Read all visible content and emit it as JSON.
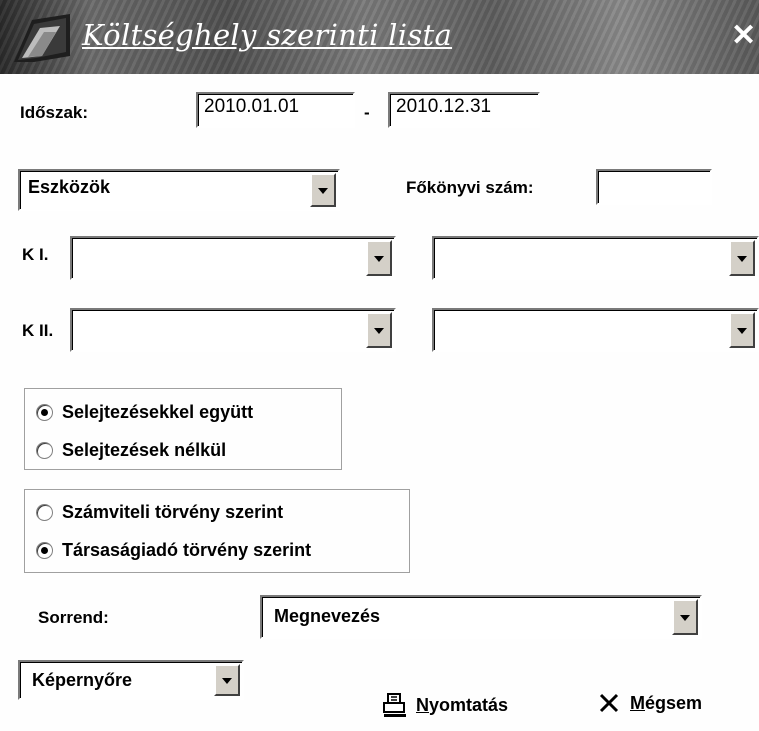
{
  "window": {
    "title": "Költséghely szerinti lista",
    "close_glyph": "✕"
  },
  "period": {
    "label": "Időszak:",
    "from": "2010.01.01",
    "separator": "-",
    "to": "2010.12.31"
  },
  "category": {
    "selected": "Eszközök"
  },
  "ledger": {
    "label": "Főkönyvi szám:",
    "value": ""
  },
  "k1": {
    "label": "K I.",
    "left_value": "",
    "right_value": ""
  },
  "k2": {
    "label": "K II.",
    "left_value": "",
    "right_value": ""
  },
  "scrap_group": {
    "options": [
      {
        "label": "Selejtezésekkel együtt",
        "checked": true
      },
      {
        "label": "Selejtezések nélkül",
        "checked": false
      }
    ]
  },
  "law_group": {
    "options": [
      {
        "label": "Számviteli törvény szerint",
        "checked": false
      },
      {
        "label": "Társaságiadó törvény szerint",
        "checked": true
      }
    ]
  },
  "order": {
    "label": "Sorrend:",
    "selected": "Megnevezés"
  },
  "output": {
    "selected": "Képernyőre"
  },
  "actions": {
    "print": {
      "mnemonic": "N",
      "rest": "yomtatás",
      "icon": "printer-icon"
    },
    "cancel": {
      "mnemonic": "M",
      "rest": "égsem",
      "icon": "x-icon"
    }
  }
}
